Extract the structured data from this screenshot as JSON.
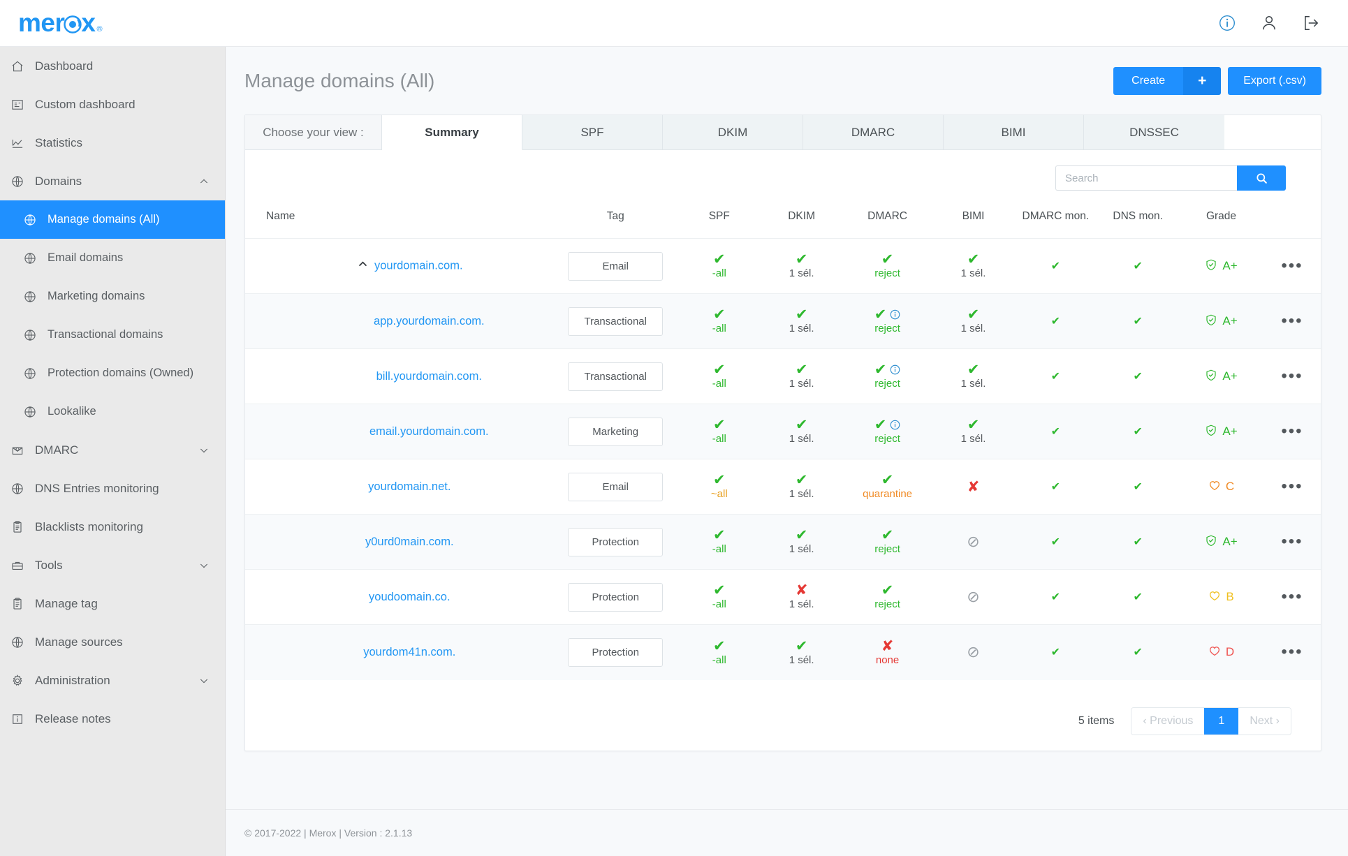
{
  "brand": {
    "name": "merox",
    "registered": "®"
  },
  "topbar": {
    "icons": [
      {
        "name": "info-icon",
        "glyph": "info"
      },
      {
        "name": "user-icon",
        "glyph": "user"
      },
      {
        "name": "logout-icon",
        "glyph": "logout"
      }
    ]
  },
  "sidebar": {
    "items": [
      {
        "label": "Dashboard",
        "icon": "home-icon",
        "level": 0,
        "active": false,
        "chevron": ""
      },
      {
        "label": "Custom dashboard",
        "icon": "layout-icon",
        "level": 0,
        "active": false,
        "chevron": ""
      },
      {
        "label": "Statistics",
        "icon": "chart-icon",
        "level": 0,
        "active": false,
        "chevron": ""
      },
      {
        "label": "Domains",
        "icon": "globe-icon",
        "level": 0,
        "active": false,
        "chevron": "up"
      },
      {
        "label": "Manage domains (All)",
        "icon": "globe-icon",
        "level": 1,
        "active": true,
        "chevron": ""
      },
      {
        "label": "Email domains",
        "icon": "globe-icon",
        "level": 1,
        "active": false,
        "chevron": ""
      },
      {
        "label": "Marketing domains",
        "icon": "globe-icon",
        "level": 1,
        "active": false,
        "chevron": ""
      },
      {
        "label": "Transactional domains",
        "icon": "globe-icon",
        "level": 1,
        "active": false,
        "chevron": ""
      },
      {
        "label": "Protection domains (Owned)",
        "icon": "globe-icon",
        "level": 1,
        "active": false,
        "chevron": ""
      },
      {
        "label": "Lookalike",
        "icon": "globe-icon",
        "level": 1,
        "active": false,
        "chevron": ""
      },
      {
        "label": "DMARC",
        "icon": "envelope-icon",
        "level": 0,
        "active": false,
        "chevron": "down"
      },
      {
        "label": "DNS Entries monitoring",
        "icon": "globe-icon",
        "level": 0,
        "active": false,
        "chevron": ""
      },
      {
        "label": "Blacklists monitoring",
        "icon": "clipboard-icon",
        "level": 0,
        "active": false,
        "chevron": ""
      },
      {
        "label": "Tools",
        "icon": "toolbox-icon",
        "level": 0,
        "active": false,
        "chevron": "down"
      },
      {
        "label": "Manage tag",
        "icon": "clipboard-icon",
        "level": 0,
        "active": false,
        "chevron": ""
      },
      {
        "label": "Manage sources",
        "icon": "globe-icon",
        "level": 0,
        "active": false,
        "chevron": ""
      },
      {
        "label": "Administration",
        "icon": "gear-icon",
        "level": 0,
        "active": false,
        "chevron": "down"
      },
      {
        "label": "Release notes",
        "icon": "info-box-icon",
        "level": 0,
        "active": false,
        "chevron": ""
      }
    ]
  },
  "page": {
    "title": "Manage domains (All)",
    "create_label": "Create",
    "create_plus": "+",
    "export_label": "Export (.csv)"
  },
  "tabs": {
    "chooser_label": "Choose your view :",
    "items": [
      {
        "label": "Summary",
        "active": true
      },
      {
        "label": "SPF",
        "active": false
      },
      {
        "label": "DKIM",
        "active": false
      },
      {
        "label": "DMARC",
        "active": false
      },
      {
        "label": "BIMI",
        "active": false
      },
      {
        "label": "DNSSEC",
        "active": false
      }
    ]
  },
  "search": {
    "placeholder": "Search",
    "value": ""
  },
  "table": {
    "headers": {
      "name": "Name",
      "tag": "Tag",
      "spf": "SPF",
      "dkim": "DKIM",
      "dmarc": "DMARC",
      "bimi": "BIMI",
      "dmarc_mon": "DMARC mon.",
      "dns_mon": "DNS mon.",
      "grade": "Grade"
    },
    "rows": [
      {
        "name": "yourdomain.com.",
        "child": false,
        "caret": "up",
        "tag": "Email",
        "spf": {
          "mark": "ok",
          "text": "-all",
          "color": "t-green",
          "info": false
        },
        "dkim": {
          "mark": "ok",
          "text": "1 sél.",
          "color": "t-gray",
          "info": false
        },
        "dmarc": {
          "mark": "ok",
          "text": "reject",
          "color": "t-green",
          "info": false
        },
        "bimi": {
          "mark": "ok",
          "text": "1 sél.",
          "color": "t-gray",
          "info": false
        },
        "dmarc_mon": "ok",
        "dns_mon": "ok",
        "grade": {
          "letter": "A+",
          "cls": "g-A",
          "shield": "check"
        }
      },
      {
        "name": "app.yourdomain.com.",
        "child": true,
        "caret": "",
        "tag": "Transactional",
        "spf": {
          "mark": "ok",
          "text": "-all",
          "color": "t-green",
          "info": false
        },
        "dkim": {
          "mark": "ok",
          "text": "1 sél.",
          "color": "t-gray",
          "info": false
        },
        "dmarc": {
          "mark": "ok",
          "text": "reject",
          "color": "t-green",
          "info": true
        },
        "bimi": {
          "mark": "ok",
          "text": "1 sél.",
          "color": "t-gray",
          "info": false
        },
        "dmarc_mon": "ok",
        "dns_mon": "ok",
        "grade": {
          "letter": "A+",
          "cls": "g-A",
          "shield": "check"
        }
      },
      {
        "name": "bill.yourdomain.com.",
        "child": true,
        "caret": "",
        "tag": "Transactional",
        "spf": {
          "mark": "ok",
          "text": "-all",
          "color": "t-green",
          "info": false
        },
        "dkim": {
          "mark": "ok",
          "text": "1 sél.",
          "color": "t-gray",
          "info": false
        },
        "dmarc": {
          "mark": "ok",
          "text": "reject",
          "color": "t-green",
          "info": true
        },
        "bimi": {
          "mark": "ok",
          "text": "1 sél.",
          "color": "t-gray",
          "info": false
        },
        "dmarc_mon": "ok",
        "dns_mon": "ok",
        "grade": {
          "letter": "A+",
          "cls": "g-A",
          "shield": "check"
        }
      },
      {
        "name": "email.yourdomain.com.",
        "child": true,
        "caret": "",
        "tag": "Marketing",
        "spf": {
          "mark": "ok",
          "text": "-all",
          "color": "t-green",
          "info": false
        },
        "dkim": {
          "mark": "ok",
          "text": "1 sél.",
          "color": "t-gray",
          "info": false
        },
        "dmarc": {
          "mark": "ok",
          "text": "reject",
          "color": "t-green",
          "info": true
        },
        "bimi": {
          "mark": "ok",
          "text": "1 sél.",
          "color": "t-gray",
          "info": false
        },
        "dmarc_mon": "ok",
        "dns_mon": "ok",
        "grade": {
          "letter": "A+",
          "cls": "g-A",
          "shield": "check"
        }
      },
      {
        "name": "yourdomain.net.",
        "child": false,
        "caret": "",
        "tag": "Email",
        "spf": {
          "mark": "ok",
          "text": "~all",
          "color": "t-amber",
          "info": false
        },
        "dkim": {
          "mark": "ok",
          "text": "1 sél.",
          "color": "t-gray",
          "info": false
        },
        "dmarc": {
          "mark": "ok",
          "text": "quarantine",
          "color": "t-orange",
          "info": false
        },
        "bimi": {
          "mark": "bad",
          "text": "",
          "color": "",
          "info": false
        },
        "dmarc_mon": "ok",
        "dns_mon": "ok",
        "grade": {
          "letter": "C",
          "cls": "g-C",
          "shield": "heart"
        }
      },
      {
        "name": "y0urd0main.com.",
        "child": false,
        "caret": "",
        "tag": "Protection",
        "spf": {
          "mark": "ok",
          "text": "-all",
          "color": "t-green",
          "info": false
        },
        "dkim": {
          "mark": "ok",
          "text": "1 sél.",
          "color": "t-gray",
          "info": false
        },
        "dmarc": {
          "mark": "ok",
          "text": "reject",
          "color": "t-green",
          "info": false
        },
        "bimi": {
          "mark": "na",
          "text": "",
          "color": "",
          "info": false
        },
        "dmarc_mon": "ok",
        "dns_mon": "ok",
        "grade": {
          "letter": "A+",
          "cls": "g-A",
          "shield": "check"
        }
      },
      {
        "name": "youdoomain.co.",
        "child": false,
        "caret": "",
        "tag": "Protection",
        "spf": {
          "mark": "ok",
          "text": "-all",
          "color": "t-green",
          "info": false
        },
        "dkim": {
          "mark": "bad",
          "text": "1 sél.",
          "color": "t-gray",
          "info": false
        },
        "dmarc": {
          "mark": "ok",
          "text": "reject",
          "color": "t-green",
          "info": false
        },
        "bimi": {
          "mark": "na",
          "text": "",
          "color": "",
          "info": false
        },
        "dmarc_mon": "ok",
        "dns_mon": "ok",
        "grade": {
          "letter": "B",
          "cls": "g-B",
          "shield": "heart"
        }
      },
      {
        "name": "yourdom41n.com.",
        "child": false,
        "caret": "",
        "tag": "Protection",
        "spf": {
          "mark": "ok",
          "text": "-all",
          "color": "t-green",
          "info": false
        },
        "dkim": {
          "mark": "ok",
          "text": "1 sél.",
          "color": "t-gray",
          "info": false
        },
        "dmarc": {
          "mark": "bad",
          "text": "none",
          "color": "t-red",
          "info": false
        },
        "bimi": {
          "mark": "na",
          "text": "",
          "color": "",
          "info": false
        },
        "dmarc_mon": "ok",
        "dns_mon": "ok",
        "grade": {
          "letter": "D",
          "cls": "g-D",
          "shield": "heart"
        }
      }
    ],
    "row_menu_glyph": "•••"
  },
  "pagination": {
    "items_text": "5 items",
    "previous": "‹ Previous",
    "current": "1",
    "next": "Next ›"
  },
  "footer": {
    "text": "© 2017-2022 | Merox | Version : 2.1.13"
  },
  "colors": {
    "accent": "#1f90ff",
    "link": "#2196f3",
    "ok": "#2eb82e",
    "bad": "#e53935",
    "warn": "#f08a24",
    "sidebar_bg": "#eaeaea"
  }
}
